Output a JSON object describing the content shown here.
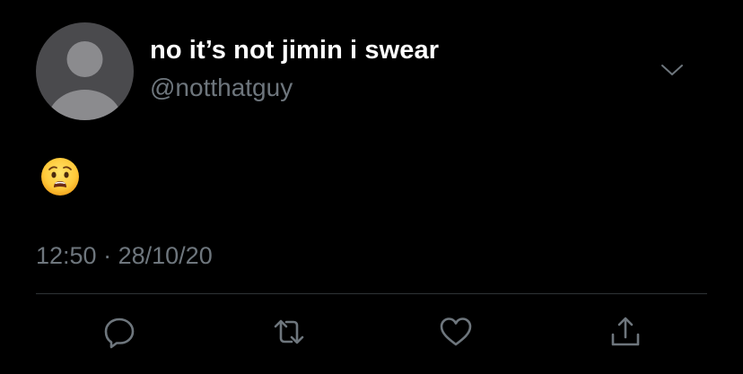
{
  "tweet": {
    "author": {
      "display_name": "no it’s not jimin i swear",
      "handle": "@notthatguy",
      "avatar_icon": "default-avatar-person-icon"
    },
    "body": {
      "emoji": "😧",
      "emoji_icon": "anguished-face-emoji"
    },
    "time": "12:50",
    "separator": "·",
    "date": "28/10/20",
    "menu_icon": "chevron-down-icon",
    "actions": [
      {
        "name": "reply",
        "icon": "reply-icon"
      },
      {
        "name": "retweet",
        "icon": "retweet-icon"
      },
      {
        "name": "like",
        "icon": "heart-icon"
      },
      {
        "name": "share",
        "icon": "share-icon"
      }
    ]
  },
  "colors": {
    "background": "#000000",
    "text_primary": "#ffffff",
    "text_secondary": "#6e767d",
    "icon": "#6e767d",
    "divider": "#2f3336",
    "avatar_bg": "#4a4a4d",
    "avatar_fg": "#8b8b8e"
  }
}
